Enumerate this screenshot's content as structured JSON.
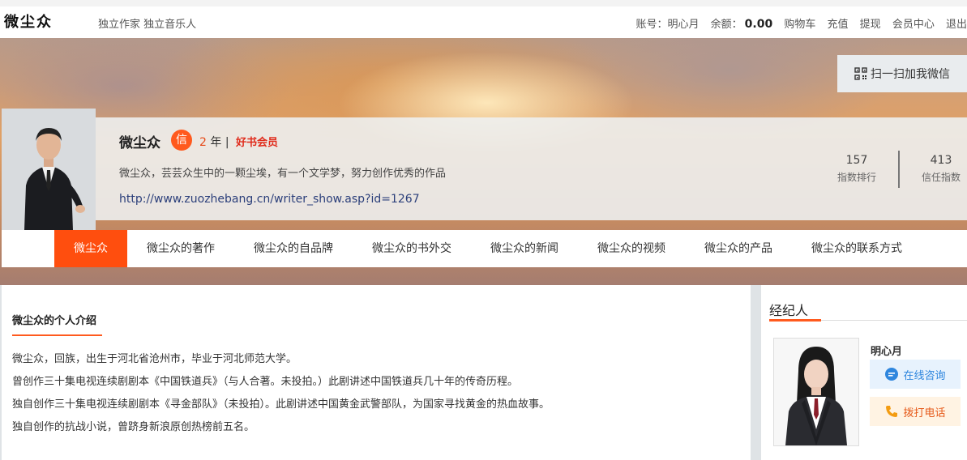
{
  "top": {
    "logo": "微尘众",
    "tagline": "独立作家 独立音乐人",
    "account_label": "账号：明心月",
    "balance_label": "余额：",
    "balance_value": "0.00",
    "links": [
      "购物车",
      "充值",
      "提现",
      "会员中心",
      "退出"
    ]
  },
  "banner": {
    "wechat_label": "扫一扫加我微信",
    "name": "微尘众",
    "badge": "信",
    "years_num": "2",
    "years_suffix": "年 |",
    "member_label": "好书会员",
    "bio": "微尘众，芸芸众生中的一颗尘埃，有一个文学梦，努力创作优秀的作品",
    "url": "http://www.zuozhebang.cn/writer_show.asp?id=1267",
    "stats": [
      {
        "value": "157",
        "label": "指数排行"
      },
      {
        "value": "413",
        "label": "信任指数"
      }
    ]
  },
  "nav": [
    {
      "label": "微尘众",
      "active": true
    },
    {
      "label": "微尘众的著作"
    },
    {
      "label": "微尘众的自品牌"
    },
    {
      "label": "微尘众的书外交"
    },
    {
      "label": "微尘众的新闻"
    },
    {
      "label": "微尘众的视频"
    },
    {
      "label": "微尘众的产品"
    },
    {
      "label": "微尘众的联系方式"
    }
  ],
  "intro": {
    "title": "微尘众的个人介绍",
    "lines": [
      "微尘众，回族，出生于河北省沧州市，毕业于河北师范大学。",
      "曾创作三十集电视连续剧剧本《中国铁道兵》（与人合著。未投拍。）此剧讲述中国铁道兵几十年的传奇历程。",
      "独自创作三十集电视连续剧剧本《寻金部队》（未投拍）。此剧讲述中国黄金武警部队，为国家寻找黄金的热血故事。",
      "独自创作的抗战小说，曾跻身新浪原创热榜前五名。"
    ]
  },
  "agent": {
    "title": "经纪人",
    "name": "明心月",
    "chat_label": "在线咨询",
    "call_label": "拨打电话"
  },
  "colors": {
    "accent": "#ff4e0e",
    "member": "#e02a1a",
    "link": "#2b3f7a"
  }
}
